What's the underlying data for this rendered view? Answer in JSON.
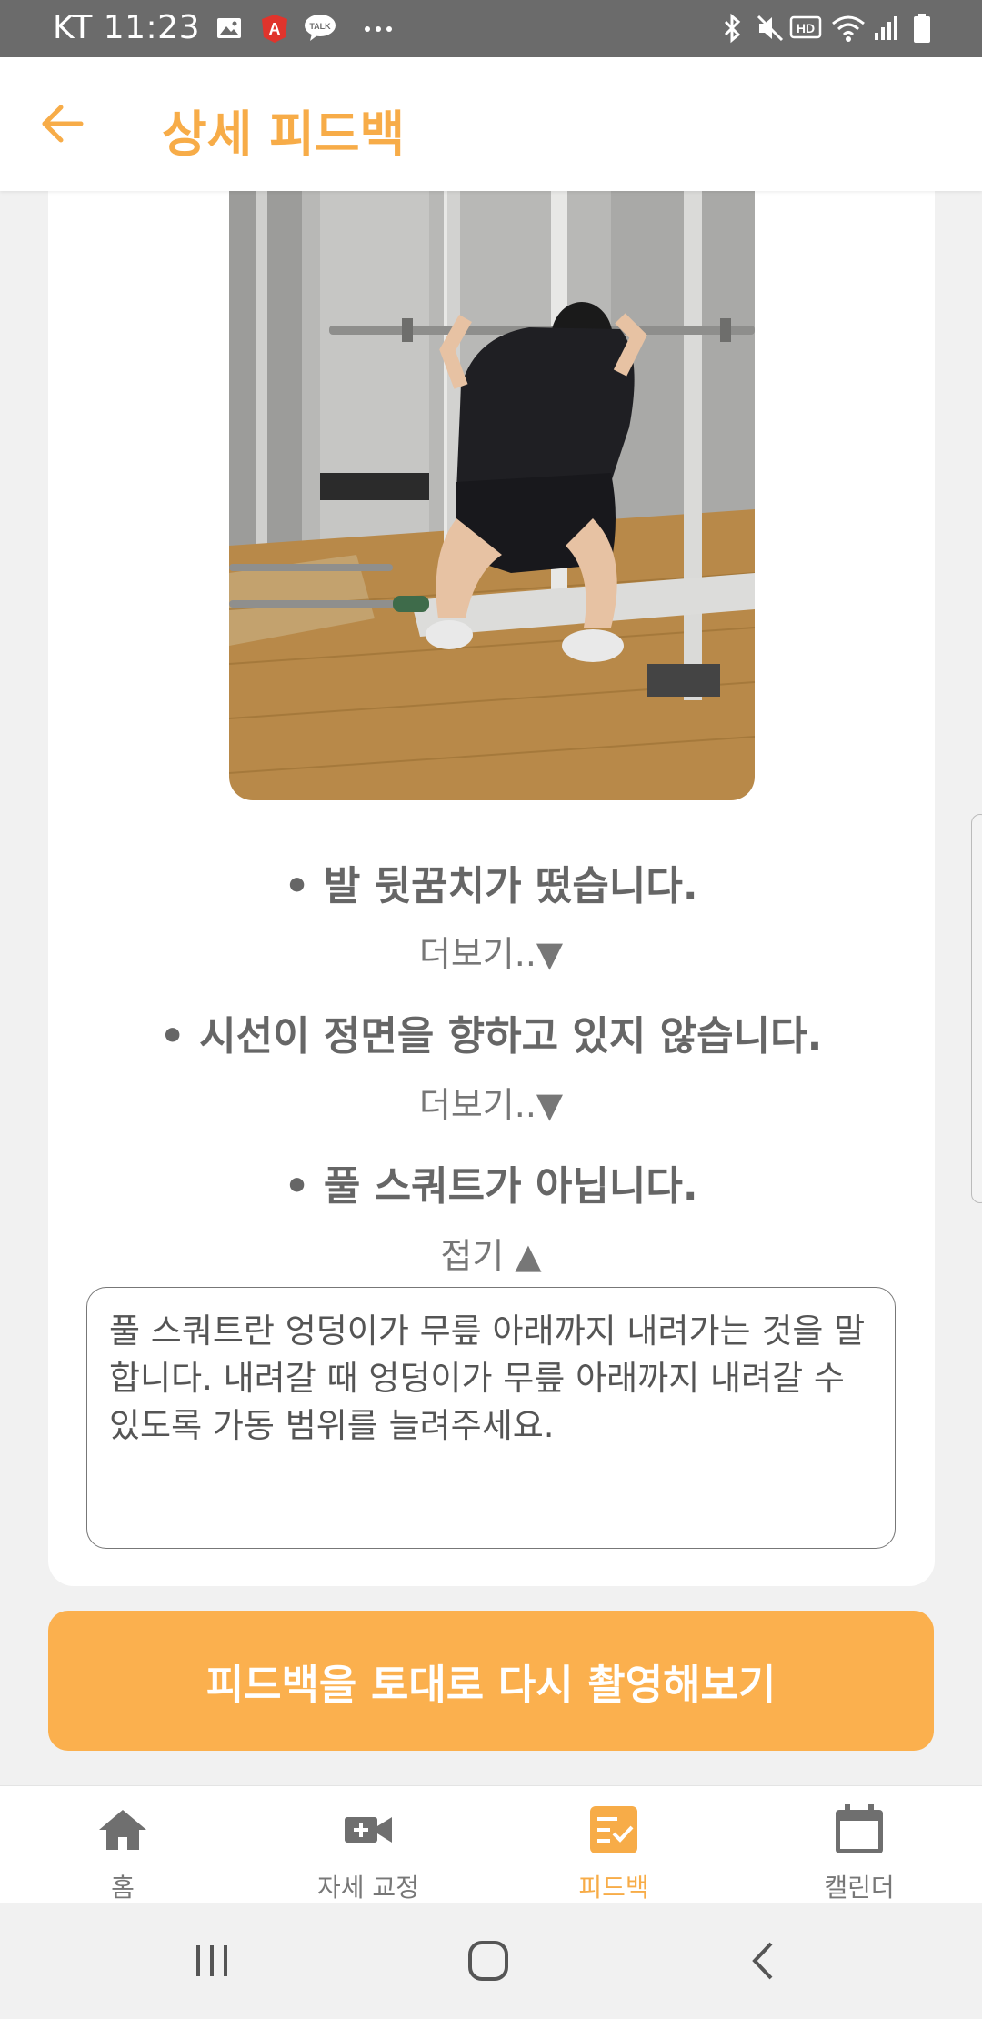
{
  "status_bar": {
    "time": "KT 11:23"
  },
  "header": {
    "title": "상세 피드백"
  },
  "feedback_items": [
    {
      "text": "• 발 뒷꿈치가 떴습니다.",
      "toggle": "더보기..▼"
    },
    {
      "text": "• 시선이 정면을 향하고 있지 않습니다.",
      "toggle": "더보기..▼"
    },
    {
      "text": "• 풀 스쿼트가 아닙니다.",
      "toggle": "접기 ▲",
      "detail": "풀 스쿼트란 엉덩이가 무릎 아래까지 내려가는 것을 말 합니다. 내려갈 때 엉덩이가 무릎 아래까지 내려갈 수 있도록 가동 범위를 늘려주세요."
    }
  ],
  "retake_button": {
    "label": "피드백을 토대로 다시 촬영해보기"
  },
  "bottom_nav": [
    {
      "label": "홈",
      "icon": "home-icon"
    },
    {
      "label": "자세 교정",
      "icon": "video-camera-icon"
    },
    {
      "label": "피드백",
      "icon": "feedback-checklist-icon",
      "active": true
    },
    {
      "label": "캘린더",
      "icon": "calendar-icon"
    }
  ],
  "colors": {
    "accent": "#f7ac48",
    "button": "#fbb04e",
    "status_bar": "#6b6b6b"
  }
}
